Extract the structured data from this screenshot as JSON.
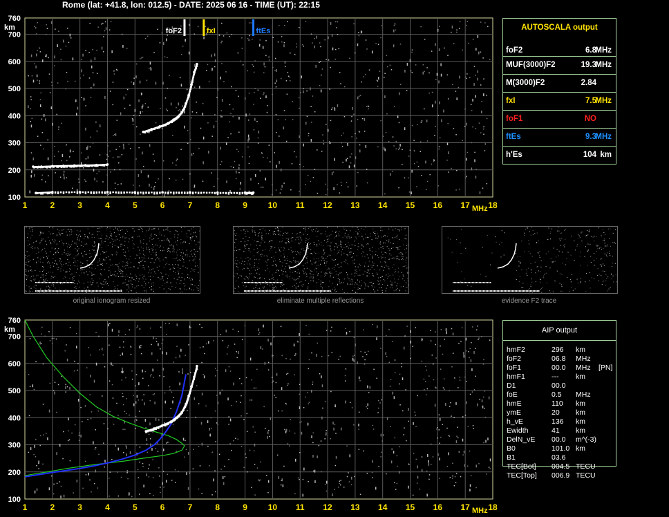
{
  "header": "Rome (lat: +41.8, lon: 012.5) - DATE: 2025 06 16 - TIME (UT): 22:15",
  "axis": {
    "y_unit": "km",
    "x_unit": "MHz"
  },
  "markers": [
    {
      "label": "foF2",
      "color": "#ffffff"
    },
    {
      "label": "fxI",
      "color": "#ffe400"
    },
    {
      "label": "ftEs",
      "color": "#1e7bff"
    }
  ],
  "autoscala": {
    "title": "AUTOSCALA output",
    "rows": [
      {
        "key": "foF2",
        "value": "6.8",
        "unit": "MHz",
        "color": "#ffffff"
      },
      {
        "key": "MUF(3000)F2",
        "value": "19.3",
        "unit": "MHz",
        "color": "#ffffff"
      },
      {
        "key": "M(3000)F2",
        "value": "2.84",
        "unit": "",
        "color": "#ffffff"
      },
      {
        "key": "fxI",
        "value": "7.5",
        "unit": "MHz",
        "color": "#ffe400"
      },
      {
        "key": "foF1",
        "value": "NO",
        "unit": "",
        "color": "#ff2020"
      },
      {
        "key": "ftEs",
        "value": "9.3",
        "unit": "MHz",
        "color": "#1e90ff"
      },
      {
        "key": "h'Es",
        "value": "104",
        "unit": "km",
        "color": "#ffffff"
      }
    ]
  },
  "thumbnails": [
    {
      "caption": "original ionogram resized"
    },
    {
      "caption": "eliminate multiple reflections"
    },
    {
      "caption": "evidence F2 trace"
    }
  ],
  "aip": {
    "title": "AIP output",
    "rows": [
      {
        "key": "hmF2",
        "value": "296",
        "unit": "km",
        "extra": ""
      },
      {
        "key": "foF2",
        "value": "06.8",
        "unit": "MHz",
        "extra": ""
      },
      {
        "key": "foF1",
        "value": "00.0",
        "unit": "MHz",
        "extra": "[PN]"
      },
      {
        "key": "hmF1",
        "value": "---",
        "unit": "km",
        "extra": ""
      },
      {
        "key": "D1",
        "value": "00.0",
        "unit": "",
        "extra": ""
      },
      {
        "key": "foE",
        "value": "0.5",
        "unit": "MHz",
        "extra": ""
      },
      {
        "key": "hmE",
        "value": "110",
        "unit": "km",
        "extra": ""
      },
      {
        "key": "ymE",
        "value": "20",
        "unit": "km",
        "extra": ""
      },
      {
        "key": "h_vE",
        "value": "136",
        "unit": "km",
        "extra": ""
      },
      {
        "key": "Ewidth",
        "value": "41",
        "unit": "km",
        "extra": ""
      },
      {
        "key": "DelN_vE",
        "value": "00.0",
        "unit": "m^(-3)",
        "extra": ""
      },
      {
        "key": "B0",
        "value": "101.0",
        "unit": "km",
        "extra": ""
      },
      {
        "key": "B1",
        "value": "03.6",
        "unit": "",
        "extra": ""
      },
      {
        "key": "TEC[Bot]",
        "value": "004.5",
        "unit": "TECU",
        "extra": ""
      },
      {
        "key": "TEC[Top]",
        "value": "006.9",
        "unit": "TECU",
        "extra": ""
      }
    ]
  },
  "chart_data": [
    {
      "type": "scatter",
      "title": "",
      "xlabel": "MHz",
      "ylabel": "km",
      "xlim": [
        1,
        18
      ],
      "ylim": [
        100,
        760
      ],
      "x_ticks": [
        1,
        2,
        3,
        4,
        5,
        6,
        7,
        8,
        9,
        10,
        11,
        12,
        13,
        14,
        15,
        16,
        17,
        18
      ],
      "y_ticks": [
        100,
        200,
        300,
        400,
        500,
        600,
        700,
        760
      ],
      "grid": true,
      "markers_mhz": {
        "foF2": 6.8,
        "fxI": 7.5,
        "ftEs": 9.3
      },
      "series": [
        {
          "name": "",
          "color": "#ffffff",
          "x": [
            5.3,
            5.6,
            5.9,
            6.2,
            6.4,
            6.6,
            6.75,
            6.85,
            6.95,
            7.05,
            7.15,
            7.25
          ],
          "y": [
            340,
            350,
            360,
            372,
            385,
            400,
            420,
            445,
            475,
            515,
            560,
            590
          ]
        },
        {
          "name": "",
          "color": "#ffffff",
          "x": [
            1.3,
            1.6,
            2,
            2.4,
            2.8,
            3.2,
            3.6,
            4
          ],
          "y": [
            212,
            212,
            214,
            215,
            216,
            217,
            218,
            220
          ]
        },
        {
          "name": "",
          "color": "#ffffff",
          "x": [
            1.4,
            2,
            3,
            4,
            5,
            6,
            7,
            8,
            9,
            9.3
          ],
          "y": [
            115,
            118,
            118,
            118,
            117,
            117,
            117,
            116,
            116,
            116
          ]
        }
      ]
    },
    {
      "type": "line",
      "title": "",
      "xlabel": "MHz",
      "ylabel": "km",
      "xlim": [
        1,
        18
      ],
      "ylim": [
        100,
        760
      ],
      "x_ticks": [
        1,
        2,
        3,
        4,
        5,
        6,
        7,
        8,
        9,
        10,
        11,
        12,
        13,
        14,
        15,
        16,
        17,
        18
      ],
      "y_ticks": [
        100,
        200,
        300,
        400,
        500,
        600,
        700,
        760
      ],
      "grid": true,
      "series": [
        {
          "name": "",
          "color": "#22cc22",
          "x": [
            1.0,
            1.3,
            1.8,
            2.4,
            3.0,
            3.6,
            4.2,
            4.8,
            5.3,
            5.8,
            6.2,
            6.5,
            6.7,
            6.8,
            6.7,
            6.4,
            6.0,
            5.4,
            4.6,
            3.6,
            2.6,
            1.8,
            1.2,
            1.0
          ],
          "y": [
            760,
            700,
            620,
            550,
            490,
            440,
            405,
            380,
            362,
            346,
            334,
            320,
            306,
            296,
            280,
            268,
            260,
            252,
            240,
            228,
            214,
            200,
            190,
            186
          ]
        },
        {
          "name": "",
          "color": "#2030ff",
          "x": [
            1.0,
            1.5,
            2.0,
            2.5,
            3.0,
            3.5,
            4.0,
            4.5,
            5.0,
            5.4,
            5.7,
            5.9,
            6.1,
            6.3,
            6.5,
            6.7,
            6.85
          ],
          "y": [
            182,
            190,
            198,
            205,
            213,
            222,
            233,
            246,
            262,
            280,
            300,
            320,
            345,
            375,
            420,
            480,
            560
          ]
        },
        {
          "name": "",
          "color": "#ffffff",
          "x": [
            5.4,
            5.7,
            6.0,
            6.3,
            6.5,
            6.7,
            6.85,
            6.95,
            7.05,
            7.15,
            7.25
          ],
          "y": [
            350,
            360,
            372,
            385,
            400,
            420,
            450,
            480,
            515,
            550,
            590
          ]
        }
      ]
    }
  ]
}
